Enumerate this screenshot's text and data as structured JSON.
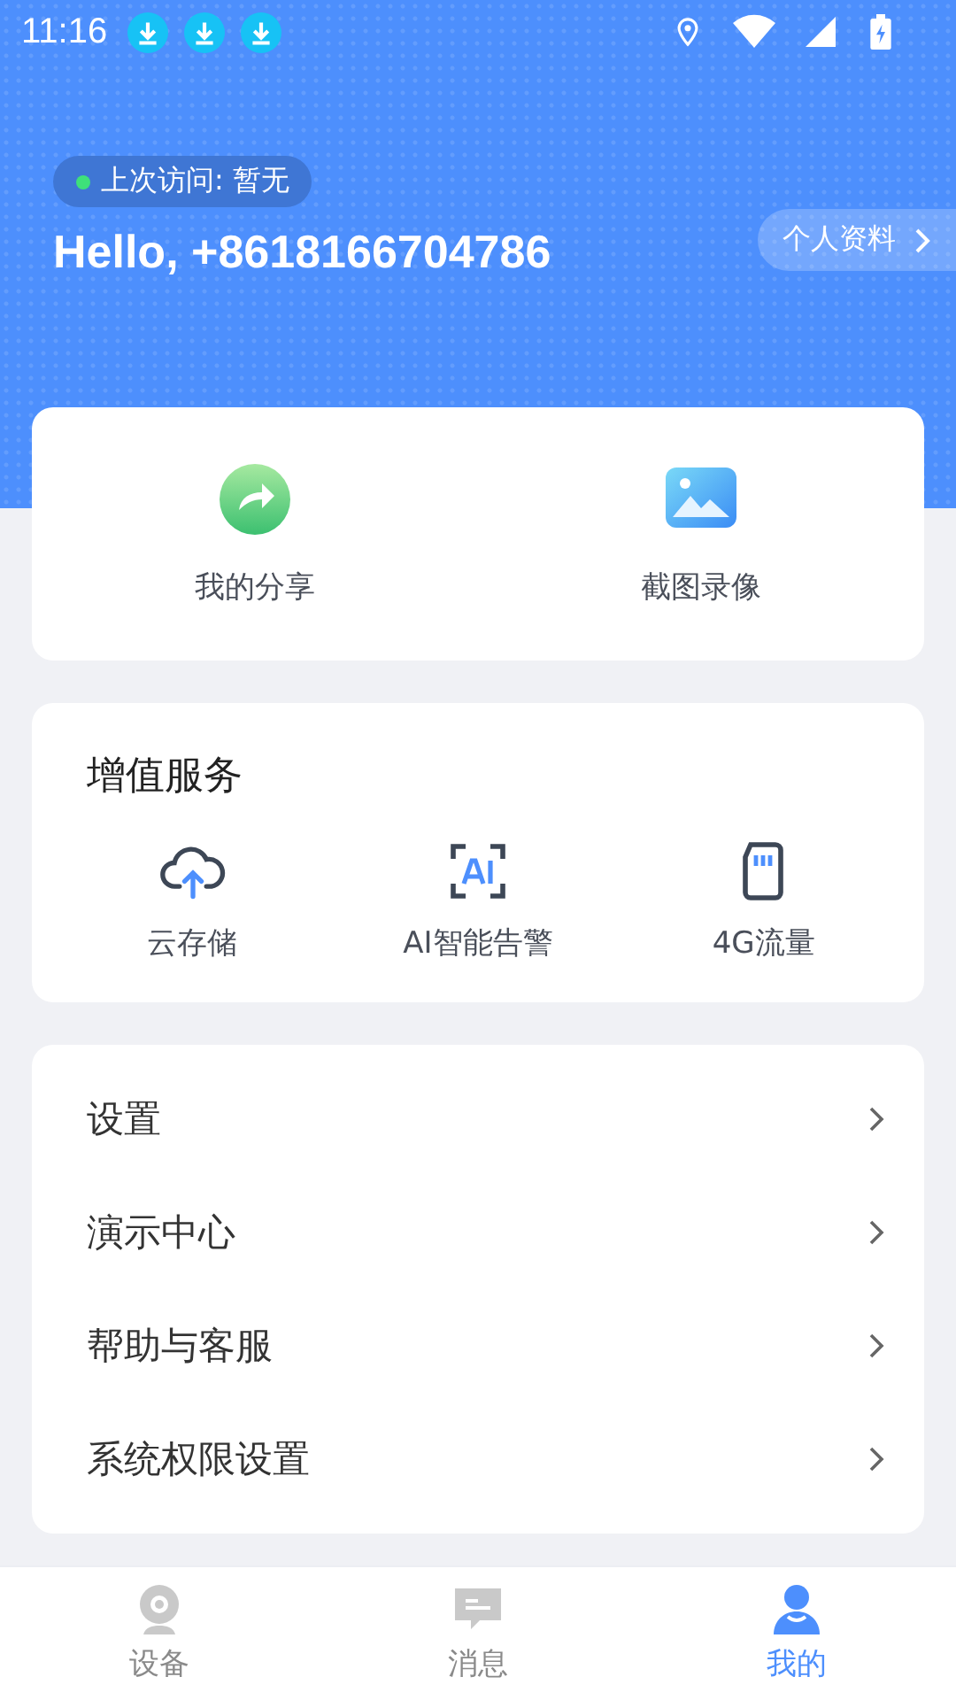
{
  "status_bar": {
    "time": "11:16",
    "notifications": [
      {
        "kind": "download"
      },
      {
        "kind": "download"
      },
      {
        "kind": "download"
      }
    ]
  },
  "header": {
    "last_visit": "上次访问: 暂无",
    "greeting": "Hello, +8618166704786",
    "profile_button": "个人资料"
  },
  "quick_actions": [
    {
      "kind": "share",
      "label": "我的分享"
    },
    {
      "kind": "gallery",
      "label": "截图录像"
    }
  ],
  "value_services": {
    "title": "增值服务",
    "items": [
      {
        "kind": "cloud",
        "label": "云存储"
      },
      {
        "kind": "ai",
        "label": "AI智能告警"
      },
      {
        "kind": "sim",
        "label": "4G流量"
      }
    ]
  },
  "menu": [
    {
      "label": "设置"
    },
    {
      "label": "演示中心"
    },
    {
      "label": "帮助与客服"
    },
    {
      "label": "系统权限设置"
    }
  ],
  "tabs": [
    {
      "kind": "device",
      "label": "设备",
      "selected": false
    },
    {
      "kind": "message",
      "label": "消息",
      "selected": false
    },
    {
      "kind": "me",
      "label": "我的",
      "selected": true
    }
  ]
}
